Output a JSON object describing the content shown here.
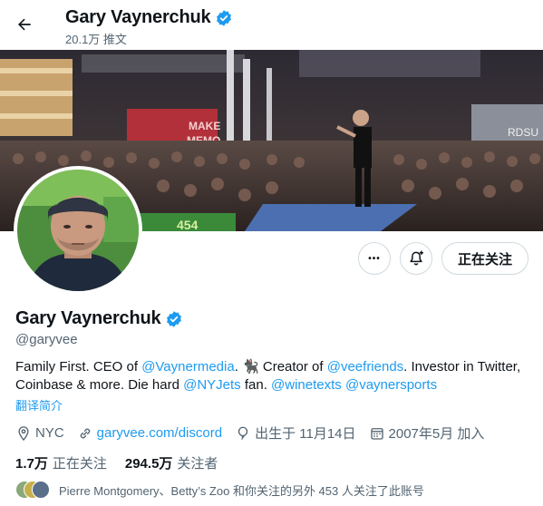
{
  "header": {
    "title": "Gary Vaynerchuk",
    "subtitle": "20.1万 推文"
  },
  "banner": {
    "sign_text_1": "MAKE",
    "sign_text_2": "MEMO",
    "sign_text_3": "RDSU",
    "sign_text_4": "454"
  },
  "actions": {
    "more_label": "•••",
    "follow_label": "正在关注"
  },
  "profile": {
    "name": "Gary Vaynerchuk",
    "handle": "@garyvee",
    "bio": {
      "p1": "Family First. CEO of ",
      "m1": "@Vaynermedia",
      "p2": ". 🐈‍⬛ Creator of ",
      "m2": "@veefriends",
      "p3": ". Investor in Twitter, Coinbase & more. Die hard ",
      "m3": "@NYJets",
      "p4": " fan. ",
      "m4": "@winetexts",
      "p5": " ",
      "m5": "@vaynersports"
    },
    "translate": "翻译简介",
    "location": "NYC",
    "website": "garyvee.com/discord",
    "birthday": "出生于 11月14日",
    "joined": "2007年5月 加入"
  },
  "stats": {
    "following_count": "1.7万",
    "following_label": "正在关注",
    "followers_count": "294.5万",
    "followers_label": "关注者"
  },
  "known_followers": "Pierre Montgomery、Betty’s Zoo 和你关注的另外 453 人关注了此账号",
  "colors": {
    "accent": "#1d9bf0",
    "secondary_text": "#536471",
    "border": "#cfd9de"
  },
  "icons": [
    "back-arrow-icon",
    "verified-badge-icon",
    "more-icon",
    "bell-plus-icon",
    "location-icon",
    "link-icon",
    "birthday-balloon-icon",
    "calendar-icon"
  ]
}
